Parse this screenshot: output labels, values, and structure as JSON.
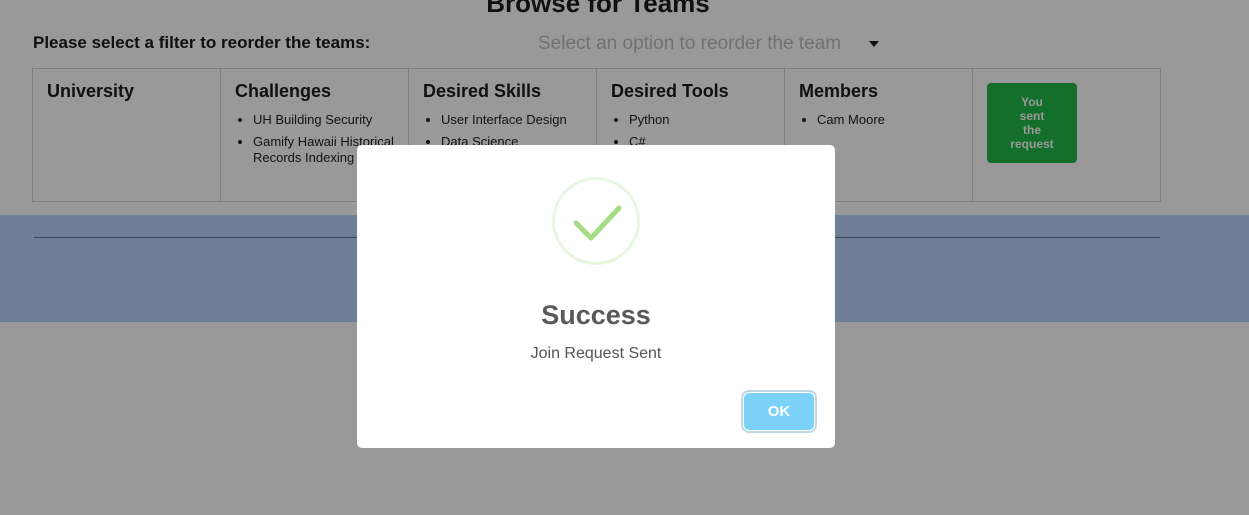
{
  "page": {
    "title": "Browse for Teams",
    "filter_label": "Please select a filter to reorder the teams:",
    "filter_placeholder": "Select an option to reorder the team"
  },
  "team": {
    "columns": {
      "university": {
        "label": "University"
      },
      "challenges": {
        "label": "Challenges",
        "items": [
          "UH Building Security",
          "Gamify Hawaii Historical Records Indexing"
        ]
      },
      "skills": {
        "label": "Desired Skills",
        "items": [
          "User Interface Design",
          "Data Science"
        ]
      },
      "tools": {
        "label": "Desired Tools",
        "items": [
          "Python",
          "C#"
        ]
      },
      "members": {
        "label": "Members",
        "items": [
          "Cam Moore"
        ]
      }
    },
    "request_button": {
      "lines": [
        "You",
        "sent",
        "the",
        "request"
      ]
    }
  },
  "modal": {
    "title": "Success",
    "text": "Join Request Sent",
    "ok_label": "OK",
    "icon": "success-check-icon"
  },
  "colors": {
    "accent_green": "#21ba45",
    "check_green": "#a5dc86",
    "ok_blue": "#7cd1f9",
    "band_blue": "#b7d2fa"
  }
}
